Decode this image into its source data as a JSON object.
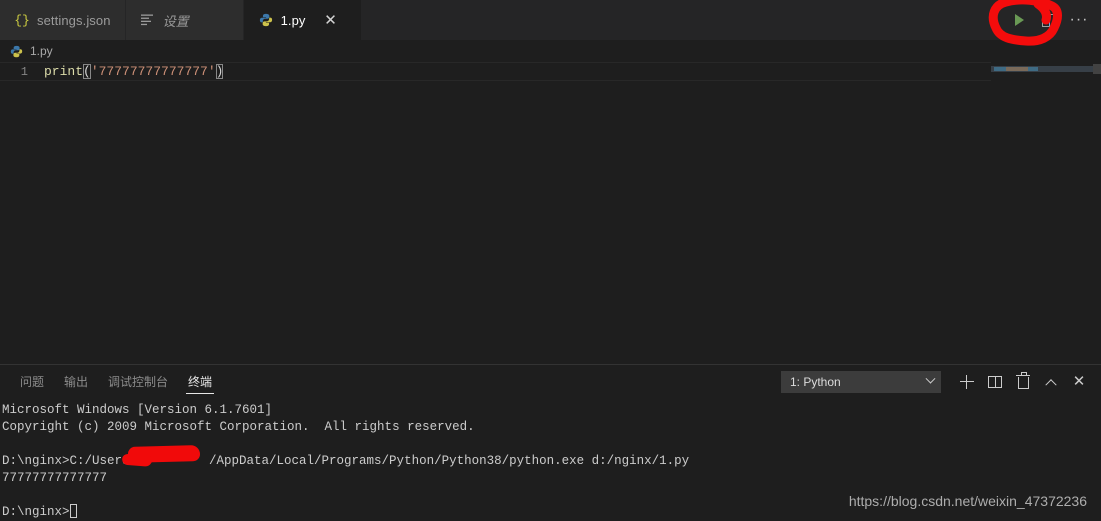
{
  "window": {
    "theme_bg": "#1e1e1e",
    "accent_red": "#f10a0a",
    "run_green": "#6a9955"
  },
  "tabbar": {
    "tabs": [
      {
        "label": "settings.json",
        "icon": "json-braces-icon",
        "active": false,
        "italic": false,
        "closable": false
      },
      {
        "label": "设置",
        "icon": "settings-list-icon",
        "active": false,
        "italic": true,
        "closable": false
      },
      {
        "label": "1.py",
        "icon": "python-icon",
        "active": true,
        "italic": false,
        "closable": true
      }
    ],
    "close_glyph": "✕",
    "actions": [
      {
        "name": "run-python-file-button",
        "icon": "play-icon",
        "label": "Run Python File"
      },
      {
        "name": "split-editor-button",
        "icon": "split-editor-icon",
        "label": "Split Editor"
      },
      {
        "name": "more-actions-button",
        "icon": "ellipsis-icon",
        "label": "···"
      }
    ]
  },
  "breadcrumb": {
    "icon": "python-icon",
    "path": "1.py"
  },
  "editor": {
    "line_number": "1",
    "code": {
      "fn": "print",
      "open_paren": "(",
      "string": "'77777777777777'",
      "close_paren": ")"
    },
    "minimap": {
      "name": "minimap"
    }
  },
  "panel": {
    "tabs": [
      {
        "label": "问题",
        "active": false
      },
      {
        "label": "输出",
        "active": false
      },
      {
        "label": "调试控制台",
        "active": false
      },
      {
        "label": "终端",
        "active": true
      }
    ],
    "terminal_select": {
      "value": "1: Python"
    },
    "actions": [
      {
        "name": "new-terminal-button",
        "icon": "plus-icon"
      },
      {
        "name": "split-terminal-button",
        "icon": "split-icon"
      },
      {
        "name": "kill-terminal-button",
        "icon": "trash-icon"
      },
      {
        "name": "maximize-panel-button",
        "icon": "chevron-up-icon"
      },
      {
        "name": "close-panel-button",
        "icon": "close-icon",
        "glyph": "✕"
      }
    ]
  },
  "terminal": {
    "lines": [
      "Microsoft Windows [Version 6.1.7601]",
      "Copyright (c) 2009 Microsoft Corporation.  All rights reserved."
    ],
    "command_prefix": "D:\\nginx>C:/Users/",
    "command_suffix": "/AppData/Local/Programs/Python/Python38/python.exe d:/nginx/1.py",
    "output": "77777777777777",
    "prompt": "D:\\nginx>"
  },
  "watermark": {
    "text": "https://blog.csdn.net/weixin_47372236"
  }
}
